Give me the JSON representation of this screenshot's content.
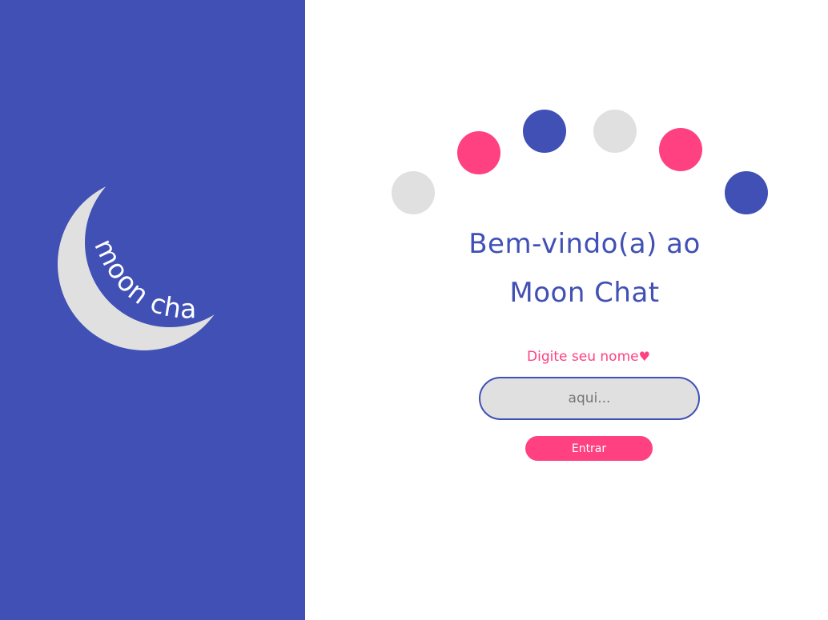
{
  "brand": {
    "logo_text": "moon chat",
    "panel_color": "#4050b5",
    "moon_color": "#e0e0e0",
    "logo_text_color": "#ffffff"
  },
  "decor": {
    "dots": [
      {
        "name": "decor-dot-gray-1",
        "color": "#e0e0e0"
      },
      {
        "name": "decor-dot-pink-1",
        "color": "#ff4081"
      },
      {
        "name": "decor-dot-blue-1",
        "color": "#4050b5"
      },
      {
        "name": "decor-dot-gray-2",
        "color": "#e0e0e0"
      },
      {
        "name": "decor-dot-pink-2",
        "color": "#ff4081"
      },
      {
        "name": "decor-dot-blue-2",
        "color": "#4050b5"
      }
    ]
  },
  "welcome": {
    "line1": "Bem-vindo(a) ao",
    "line2": "Moon Chat"
  },
  "form": {
    "label": "Digite seu nome",
    "heart": "♥",
    "input_value": "",
    "input_placeholder": "aqui...",
    "submit_label": "Entrar"
  },
  "colors": {
    "accent": "#ff4081",
    "primary": "#4050b5",
    "neutral": "#e0e0e0"
  }
}
